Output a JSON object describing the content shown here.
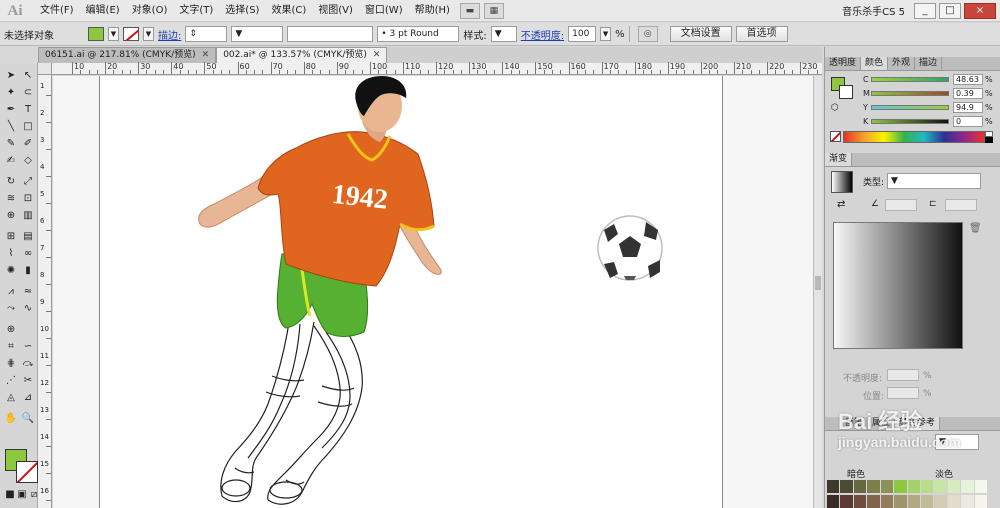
{
  "app": {
    "logo": "Ai",
    "workspace": "音乐杀手CS 5"
  },
  "menu": [
    "文件(F)",
    "编辑(E)",
    "对象(O)",
    "文字(T)",
    "选择(S)",
    "效果(C)",
    "视图(V)",
    "窗口(W)",
    "帮助(H)"
  ],
  "window_buttons": {
    "minimize": "_",
    "restore": "□",
    "close": "×"
  },
  "control": {
    "selection_status": "未选择对象",
    "stroke_label": "描边:",
    "brush_profile": "3 pt Round",
    "style_label": "样式:",
    "opacity_label": "不透明度:",
    "opacity_value": "100",
    "opacity_unit": "%",
    "doc_setup": "文档设置",
    "preferences": "首选项"
  },
  "tabs": [
    {
      "label": "06151.ai @ 217.81% (CMYK/预览)",
      "active": false
    },
    {
      "label": "002.ai* @ 133.57% (CMYK/预览)",
      "active": true
    }
  ],
  "ruler": {
    "h_labels": [
      "10",
      "20",
      "30",
      "40",
      "50",
      "60",
      "70",
      "80",
      "90",
      "100",
      "110",
      "120",
      "130",
      "140",
      "150",
      "160",
      "170",
      "180",
      "190",
      "200",
      "210",
      "220",
      "230"
    ],
    "v_labels": [
      "1",
      "2",
      "3",
      "4",
      "5",
      "6",
      "7",
      "8",
      "9",
      "10",
      "11",
      "12",
      "13",
      "14",
      "15",
      "16"
    ]
  },
  "artwork": {
    "jersey_number": "1942"
  },
  "color_panel": {
    "tabs": [
      "透明度",
      "颜色",
      "外观",
      "描边"
    ],
    "active_tab": "颜色",
    "fill_hex": "#8dc63f",
    "sliders": [
      {
        "letter": "C",
        "value": "48.63",
        "color": "#00aeef"
      },
      {
        "letter": "M",
        "value": "0.39",
        "color": "#ec008c"
      },
      {
        "letter": "Y",
        "value": "94.9",
        "color": "#fff200"
      },
      {
        "letter": "K",
        "value": "0",
        "color": "#231f20"
      }
    ],
    "unit": "%"
  },
  "gradient_panel": {
    "title": "渐变",
    "type_label": "类型:",
    "opacity_label": "不透明度:",
    "position_label": "位置:",
    "unit": "%"
  },
  "guide_panel": {
    "tabs": [
      "画笔",
      "属性",
      "颜色参考"
    ],
    "labels": [
      "暗色",
      "淡色"
    ]
  },
  "watermark": {
    "line1": "Bai 经验",
    "line2": "jingyan.baidu.com"
  }
}
